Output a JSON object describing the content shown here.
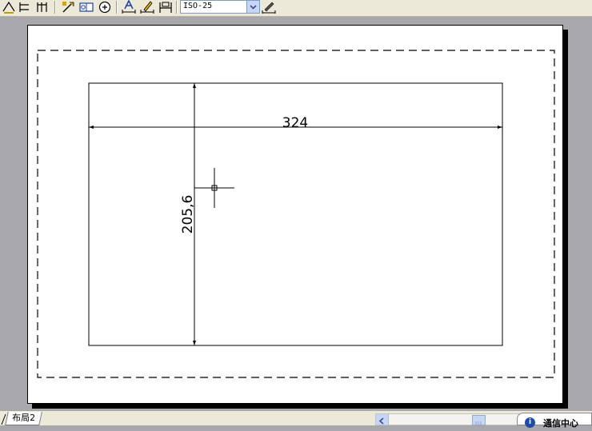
{
  "toolbar": {
    "icons": [
      "dim-linear-icon",
      "dim-aligned-icon",
      "dim-baseline-icon",
      "quick-leader-icon",
      "tolerance-icon",
      "center-mark-icon",
      "dim-text-edit-icon",
      "dim-edit-icon",
      "dim-update-icon",
      "dim-style-icon"
    ],
    "dimstyle_value": "ISO-25"
  },
  "drawing": {
    "horizontal_dimension": "324",
    "vertical_dimension": "205,6"
  },
  "layout_tabs": {
    "tab_label": "布局2"
  },
  "comm_center": {
    "label": "通信中心",
    "icon_glyph": "i"
  },
  "colors": {
    "workspace_bg": "#a8a7ab",
    "paper": "#ffffff",
    "toolbar_bg": "#ece9d8"
  }
}
